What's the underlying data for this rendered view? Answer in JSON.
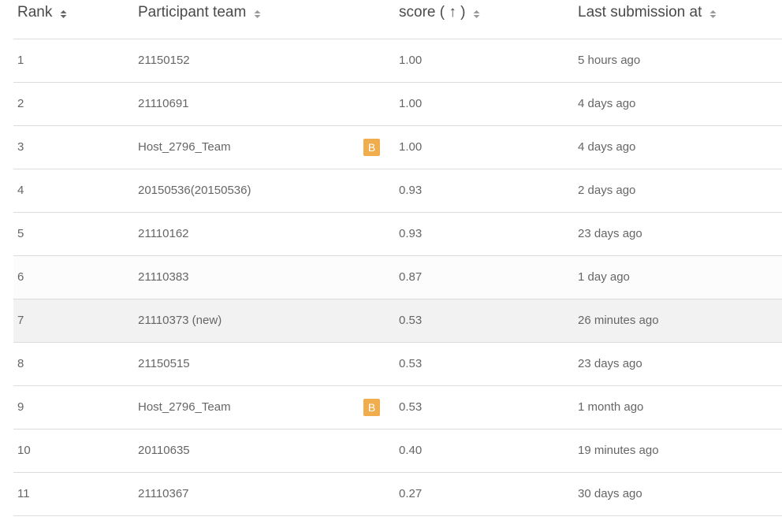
{
  "columns": {
    "rank": "Rank",
    "team": "Participant team",
    "score": "score ( ↑ )",
    "last": "Last submission at"
  },
  "rows": [
    {
      "rank": "1",
      "team": "21150152",
      "badge": "",
      "score": "1.00",
      "last": "5 hours ago"
    },
    {
      "rank": "2",
      "team": "21110691",
      "badge": "",
      "score": "1.00",
      "last": "4 days ago"
    },
    {
      "rank": "3",
      "team": "Host_2796_Team",
      "badge": "B",
      "score": "1.00",
      "last": "4 days ago"
    },
    {
      "rank": "4",
      "team": "20150536(20150536)",
      "badge": "",
      "score": "0.93",
      "last": "2 days ago"
    },
    {
      "rank": "5",
      "team": "21110162",
      "badge": "",
      "score": "0.93",
      "last": "23 days ago"
    },
    {
      "rank": "6",
      "team": "21110383",
      "badge": "",
      "score": "0.87",
      "last": "1 day ago"
    },
    {
      "rank": "7",
      "team": "21110373 (new)",
      "badge": "",
      "score": "0.53",
      "last": "26 minutes ago"
    },
    {
      "rank": "8",
      "team": "21150515",
      "badge": "",
      "score": "0.53",
      "last": "23 days ago"
    },
    {
      "rank": "9",
      "team": "Host_2796_Team",
      "badge": "B",
      "score": "0.53",
      "last": "1 month ago"
    },
    {
      "rank": "10",
      "team": "20110635",
      "badge": "",
      "score": "0.40",
      "last": "19 minutes ago"
    },
    {
      "rank": "11",
      "team": "21110367",
      "badge": "",
      "score": "0.27",
      "last": "30 days ago"
    }
  ],
  "colors": {
    "badge": "#f0ad4e",
    "highlight_row": "#f2f2f2",
    "border": "#dcdcdc"
  }
}
